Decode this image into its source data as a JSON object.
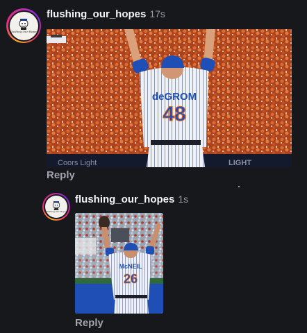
{
  "comments": [
    {
      "username": "flushing_our_hopes",
      "time": "17s",
      "reply_label": "Reply",
      "avatar_text": "Flushing Our Hopes",
      "image": {
        "subject": "pitcher celebrating with arms raised",
        "jersey_name": "deGROM",
        "jersey_number": "48",
        "signage_left": "Coors Light",
        "signage_right": "LIGHT"
      }
    },
    {
      "username": "flushing_our_hopes",
      "time": "1s",
      "reply_label": "Reply",
      "avatar_text": "Flushing Our Hopes",
      "image": {
        "subject": "player celebrating with arms raised",
        "jersey_name": "McNEIL",
        "jersey_number": "26"
      }
    }
  ],
  "colors": {
    "background": "#17181b",
    "crowd_orange": "#d9602a",
    "mets_blue": "#1f4fb4",
    "pinstripe": "#e9ecf2"
  }
}
